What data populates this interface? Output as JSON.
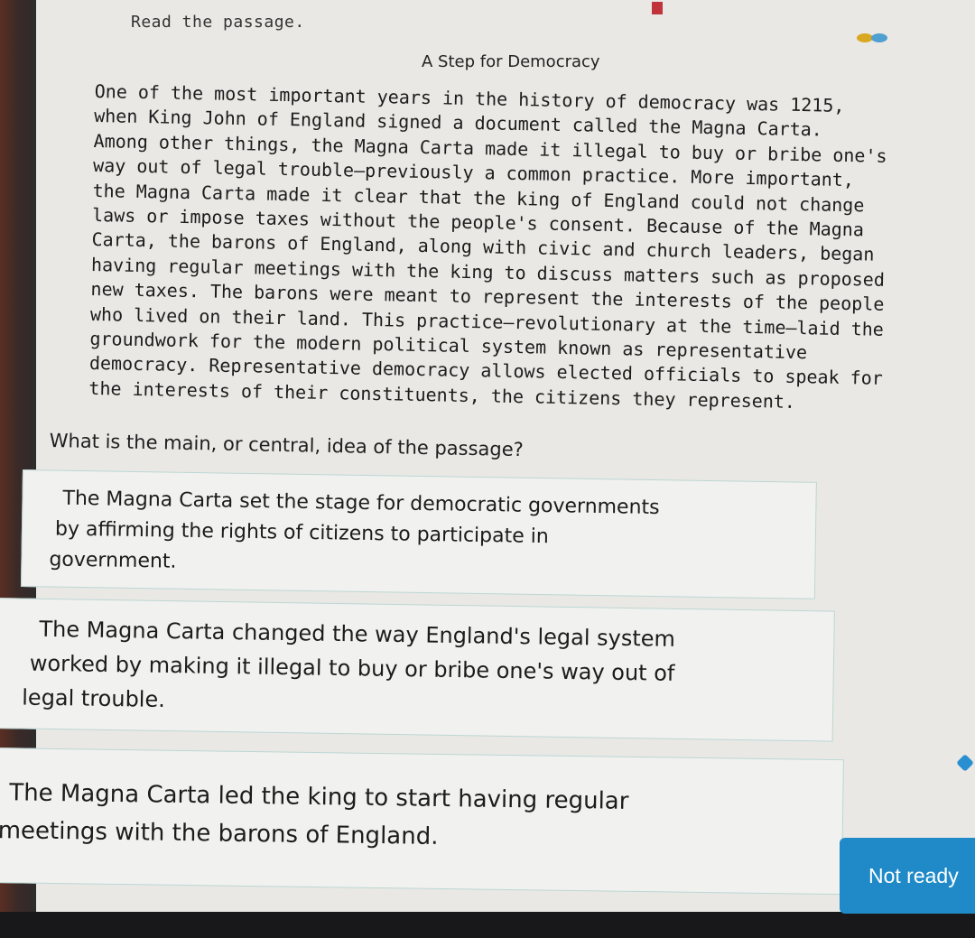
{
  "header": {
    "instructions": "Read the passage."
  },
  "passage": {
    "title": "A Step for Democracy",
    "lines": [
      "One of the most important years in the history of democracy was 1215,",
      "when King John of England signed a document called the Magna Carta.",
      "Among other things, the Magna Carta made it illegal to buy or bribe one's",
      "way out of legal trouble—previously a common practice. More important,",
      "the Magna Carta made it clear that the king of England could not change",
      "laws or impose taxes without the people's consent. Because of the Magna",
      "Carta, the barons of England, along with civic and church leaders, began",
      "having regular meetings with the king to discuss matters such as proposed",
      "new taxes. The barons were meant to represent the interests of the people",
      "who lived on their land. This practice—revolutionary at the time—laid the",
      "groundwork for the modern political system known as representative",
      "democracy. Representative democracy allows elected officials to speak for",
      "the interests of their constituents, the citizens they represent."
    ]
  },
  "question": "What is the main, or central, idea of the passage?",
  "choices": [
    {
      "lines": [
        "The Magna Carta set the stage for democratic governments",
        "by affirming the rights of citizens to participate in",
        "government."
      ]
    },
    {
      "lines": [
        "The Magna Carta changed the way England's legal system",
        "worked by making it illegal to buy or bribe one's way out of",
        "legal trouble."
      ]
    },
    {
      "lines": [
        "The Magna Carta led the king to start having regular",
        "meetings with the barons of England."
      ]
    }
  ],
  "submit": {
    "label": "Not ready"
  },
  "colors": {
    "accent": "#1f8ac7",
    "bookmark": "#c0333a",
    "choice_border": "#bcd6d3"
  }
}
